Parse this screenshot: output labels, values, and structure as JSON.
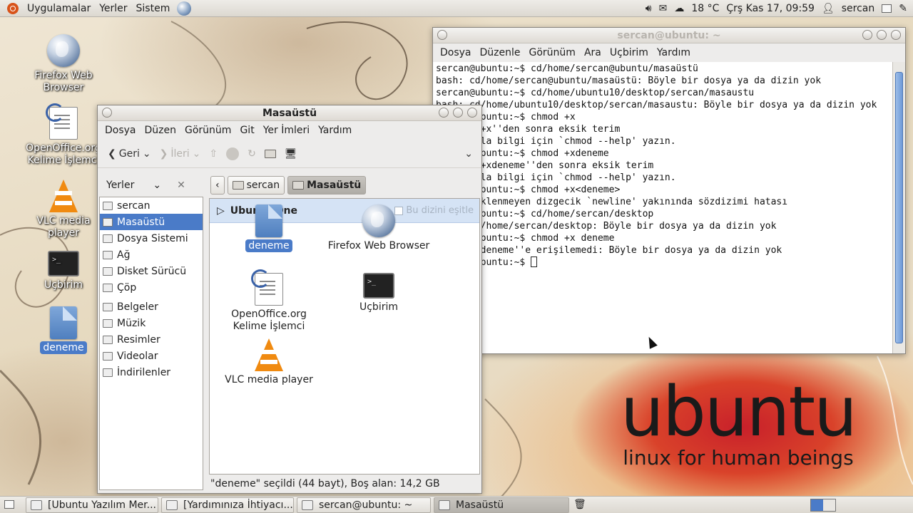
{
  "top_panel": {
    "menus": [
      "Uygulamalar",
      "Yerler",
      "Sistem"
    ],
    "temperature": "18 °C",
    "datetime": "Çrş Kas 17, 09:59",
    "user": "sercan"
  },
  "desktop_icons": [
    {
      "label": "Firefox Web Browser"
    },
    {
      "label": "OpenOffice.org Kelime İşlemci"
    },
    {
      "label": "VLC media player"
    },
    {
      "label": "Uçbirim"
    },
    {
      "label": "deneme"
    }
  ],
  "terminal": {
    "title": "sercan@ubuntu: ~",
    "menu": [
      "Dosya",
      "Düzenle",
      "Görünüm",
      "Ara",
      "Uçbirim",
      "Yardım"
    ],
    "lines": [
      "sercan@ubuntu:~$ cd/home/sercan@ubuntu/masaüstü",
      "bash: cd/home/sercan@ubuntu/masaüstü: Böyle bir dosya ya da dizin yok",
      "sercan@ubuntu:~$ cd/home/ubuntu10/desktop/sercan/masaustu",
      "bash: cd/home/ubuntu10/desktop/sercan/masaustu: Böyle bir dosya ya da dizin yok",
      "sercan@ubuntu:~$ chmod +x",
      "chmod: '+x''den sonra eksik terim",
      "Daha fazla bilgi için `chmod --help' yazın.",
      "sercan@ubuntu:~$ chmod +xdeneme",
      "chmod: '+xdeneme''den sonra eksik terim",
      "Daha fazla bilgi için `chmod --help' yazın.",
      "sercan@ubuntu:~$ chmod +x<deneme>",
      "bash: beklenmeyen dizgecik `newline' yakınında sözdizimi hatası",
      "sercan@ubuntu:~$ cd/home/sercan/desktop",
      "bash: cd/home/sercan/desktop: Böyle bir dosya ya da dizin yok",
      "sercan@ubuntu:~$ chmod +x deneme",
      "chmod: 'deneme''e erişilemedi: Böyle bir dosya ya da dizin yok",
      "sercan@ubuntu:~$ "
    ]
  },
  "nautilus": {
    "title": "Masaüstü",
    "menu": [
      "Dosya",
      "Düzen",
      "Görünüm",
      "Git",
      "Yer İmleri",
      "Yardım"
    ],
    "back_label": "Geri",
    "forward_label": "İleri",
    "sidebar_header": "Yerler",
    "places": [
      "sercan",
      "Masaüstü",
      "Dosya Sistemi",
      "Ağ",
      "Disket Sürücü",
      "Çöp"
    ],
    "bookmarks": [
      "Belgeler",
      "Müzik",
      "Resimler",
      "Videolar",
      "İndirilenler"
    ],
    "path": [
      "sercan",
      "Masaüstü"
    ],
    "ubuntu_one_label": "Ubuntu One",
    "sync_label": "Bu dizini eşitle",
    "files": [
      {
        "label": "deneme"
      },
      {
        "label": "Firefox Web Browser"
      },
      {
        "label": "OpenOffice.org Kelime İşlemci"
      },
      {
        "label": "Uçbirim"
      },
      {
        "label": "VLC media player"
      }
    ],
    "status": "\"deneme\" seçildi (44 bayt), Boş alan: 14,2 GB"
  },
  "taskbar": [
    {
      "label": "[Ubuntu Yazılım Mer..."
    },
    {
      "label": "[Yardımınıza İhtiyacı..."
    },
    {
      "label": "sercan@ubuntu: ~"
    },
    {
      "label": "Masaüstü"
    }
  ],
  "wallpaper": {
    "logo_text": "ubuntu",
    "tagline": "linux for human beings"
  }
}
